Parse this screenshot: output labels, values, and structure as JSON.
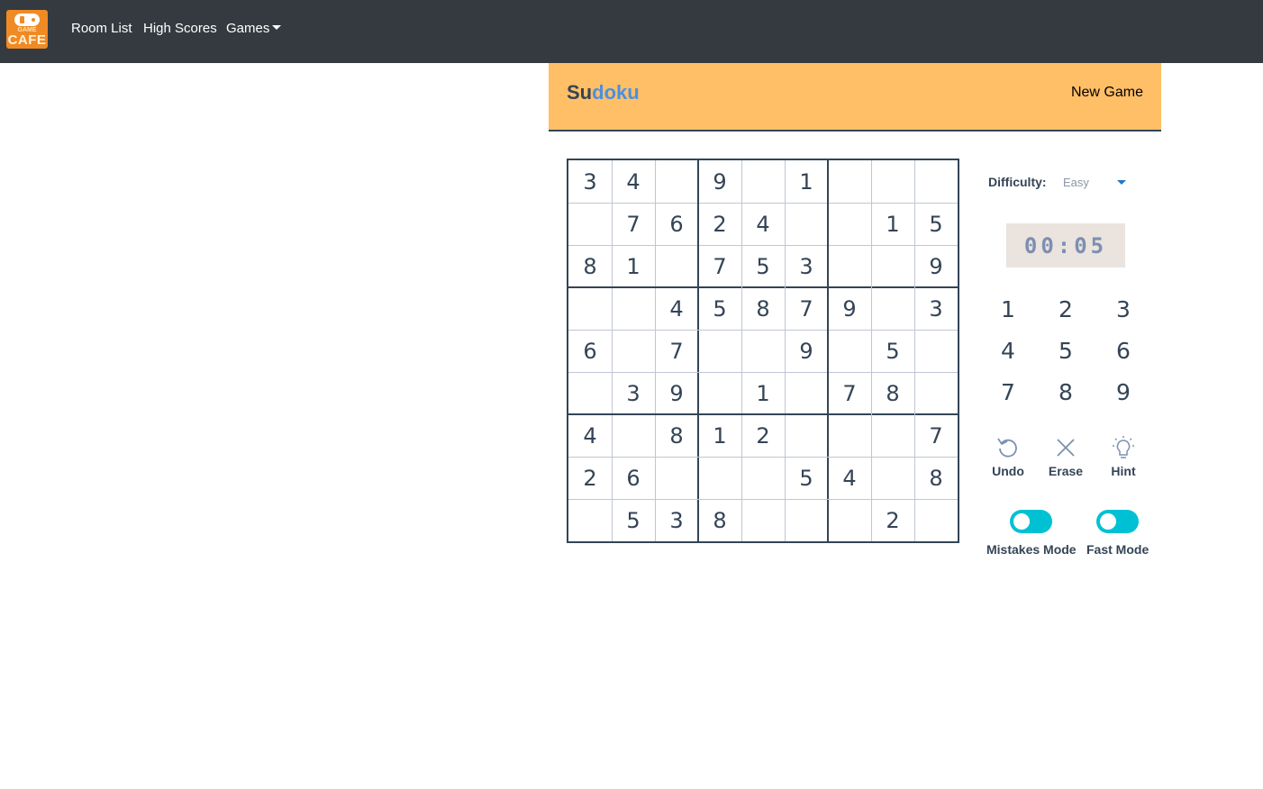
{
  "navbar": {
    "logo_text_small": "GAME",
    "logo_text_big": "CAFE",
    "links": [
      "Room List",
      "High Scores",
      "Games"
    ]
  },
  "header": {
    "title_part1": "Su",
    "title_part2": "doku",
    "new_game_label": "New Game"
  },
  "board": [
    [
      "3",
      "4",
      "",
      "9",
      "",
      "1",
      "",
      "",
      ""
    ],
    [
      "",
      "7",
      "6",
      "2",
      "4",
      "",
      "",
      "1",
      "5"
    ],
    [
      "8",
      "1",
      "",
      "7",
      "5",
      "3",
      "",
      "",
      "9"
    ],
    [
      "",
      "",
      "4",
      "5",
      "8",
      "7",
      "9",
      "",
      "3"
    ],
    [
      "6",
      "",
      "7",
      "",
      "",
      "9",
      "",
      "5",
      ""
    ],
    [
      "",
      "3",
      "9",
      "",
      "1",
      "",
      "7",
      "8",
      ""
    ],
    [
      "4",
      "",
      "8",
      "1",
      "2",
      "",
      "",
      "",
      "7"
    ],
    [
      "2",
      "6",
      "",
      "",
      "",
      "5",
      "4",
      "",
      "8"
    ],
    [
      "",
      "5",
      "3",
      "8",
      "",
      "",
      "",
      "2",
      ""
    ]
  ],
  "controls": {
    "difficulty_label": "Difficulty:",
    "difficulty_value": "Easy",
    "timer": "00:05",
    "numpad": [
      "1",
      "2",
      "3",
      "4",
      "5",
      "6",
      "7",
      "8",
      "9"
    ],
    "tools": {
      "undo": "Undo",
      "erase": "Erase",
      "hint": "Hint"
    },
    "toggles": {
      "mistakes_mode": "Mistakes Mode",
      "fast_mode": "Fast Mode"
    }
  },
  "colors": {
    "navbar": "#343a40",
    "header": "#ffbf66",
    "toggle": "#00c1d4",
    "text": "#344456"
  }
}
